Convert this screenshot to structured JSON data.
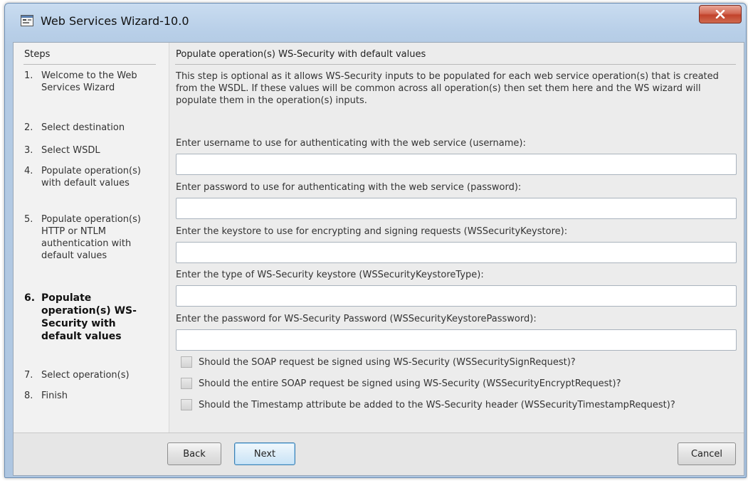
{
  "window": {
    "title": "Web Services Wizard-10.0"
  },
  "steps": {
    "header": "Steps",
    "items": [
      {
        "num": "1.",
        "label": "Welcome to the Web Services Wizard"
      },
      {
        "num": "2.",
        "label": "Select destination"
      },
      {
        "num": "3.",
        "label": "Select WSDL"
      },
      {
        "num": "4.",
        "label": "Populate operation(s) with default values"
      },
      {
        "num": "5.",
        "label": "Populate operation(s) HTTP or NTLM authentication with default values"
      },
      {
        "num": "6.",
        "label": "Populate operation(s) WS-Security with default values"
      },
      {
        "num": "7.",
        "label": "Select operation(s)"
      },
      {
        "num": "8.",
        "label": "Finish"
      }
    ],
    "active_index": 5
  },
  "content": {
    "title": "Populate operation(s) WS-Security with default values",
    "description": "This step is optional as it allows WS-Security inputs  to be populated for each web service operation(s) that is created from the WSDL. If these values will be common across all operation(s) then set them here and the WS wizard will populate them in the operation(s) inputs.",
    "fields": [
      {
        "label": "Enter username to use for authenticating with the web service (username):",
        "value": ""
      },
      {
        "label": "Enter password to use for authenticating with the web service (password):",
        "value": ""
      },
      {
        "label": "Enter the keystore to use for encrypting and signing requests (WSSecurityKeystore):",
        "value": ""
      },
      {
        "label": "Enter the type of WS-Security keystore (WSSecurityKeystoreType):",
        "value": ""
      },
      {
        "label": "Enter the password for WS-Security Password (WSSecurityKeystorePassword):",
        "value": ""
      }
    ],
    "checkboxes": [
      {
        "label": "Should the SOAP request be signed using WS-Security (WSSecuritySignRequest)?",
        "checked": false
      },
      {
        "label": "Should the entire SOAP request be signed using WS-Security (WSSecurityEncryptRequest)?",
        "checked": false
      },
      {
        "label": "Should the Timestamp attribute be added to the WS-Security header (WSSecurityTimestampRequest)?",
        "checked": false
      }
    ]
  },
  "buttons": {
    "back": "Back",
    "next": "Next",
    "cancel": "Cancel"
  },
  "icons": {
    "app": "wizard-window-icon",
    "close": "close-icon"
  },
  "colors": {
    "title_bar": "#b8cfe8",
    "close_button": "#c2432c",
    "default_button_border": "#3c7fb1"
  }
}
